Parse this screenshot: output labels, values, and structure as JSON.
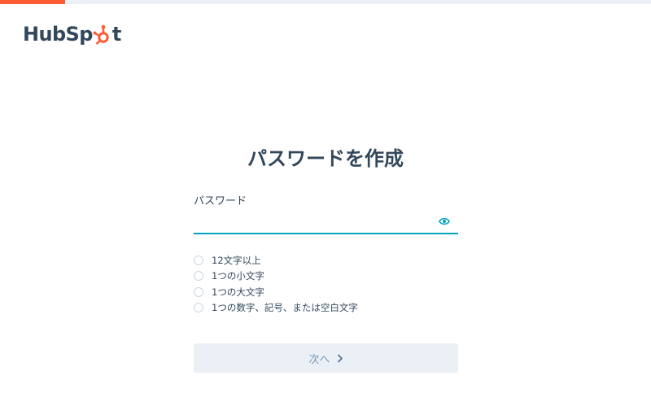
{
  "progress": {
    "fraction": 0.1
  },
  "brand": {
    "name_part1": "HubSp",
    "name_part2": "t",
    "logo_icon": "sprocket-icon",
    "accent": "#ff5c35"
  },
  "page": {
    "title": "パスワードを作成"
  },
  "password": {
    "label": "パスワード",
    "value": "",
    "placeholder": "",
    "toggle_icon": "eye-icon",
    "focus_color": "#00a4bd"
  },
  "requirements": [
    {
      "text": "12文字以上",
      "met": false
    },
    {
      "text": "1つの小文字",
      "met": false
    },
    {
      "text": "1つの大文字",
      "met": false
    },
    {
      "text": "1つの数字、記号、または空白文字",
      "met": false
    }
  ],
  "next_button": {
    "label": "次へ",
    "icon": "chevron-right-icon",
    "enabled": false
  }
}
